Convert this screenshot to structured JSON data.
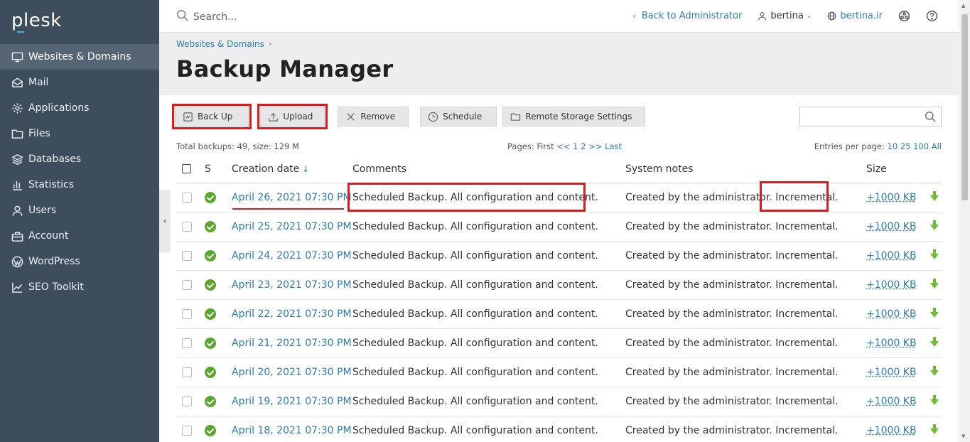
{
  "brand": {
    "logo_text": "plesk"
  },
  "sidebar": {
    "items": [
      {
        "label": "Websites & Domains",
        "icon": "monitor-icon",
        "active": true
      },
      {
        "label": "Mail",
        "icon": "mail-icon",
        "active": false
      },
      {
        "label": "Applications",
        "icon": "gear-icon",
        "active": false
      },
      {
        "label": "Files",
        "icon": "folder-icon",
        "active": false
      },
      {
        "label": "Databases",
        "icon": "database-icon",
        "active": false
      },
      {
        "label": "Statistics",
        "icon": "bar-chart-icon",
        "active": false
      },
      {
        "label": "Users",
        "icon": "user-icon",
        "active": false
      },
      {
        "label": "Account",
        "icon": "briefcase-icon",
        "active": false
      },
      {
        "label": "WordPress",
        "icon": "wordpress-icon",
        "active": false
      },
      {
        "label": "SEO Toolkit",
        "icon": "seo-chart-icon",
        "active": false
      }
    ],
    "collapse_glyph": "‹"
  },
  "topbar": {
    "search_placeholder": "Search...",
    "back_label": "Back to Administrator",
    "user_name": "bertina",
    "domain": "bertina.ir"
  },
  "header": {
    "breadcrumb": "Websites & Domains",
    "title": "Backup Manager"
  },
  "toolbar": {
    "backup_label": "Back Up",
    "upload_label": "Upload",
    "remove_label": "Remove",
    "schedule_label": "Schedule",
    "remote_label": "Remote Storage Settings"
  },
  "summary": {
    "total": "Total backups: 49, size: 129 M",
    "pages_prefix": "Pages: ",
    "first": "First",
    "prev": "<<",
    "page1": "1",
    "page2": "2",
    "next": ">>",
    "last": "Last",
    "per_prefix": "Entries per page: ",
    "per_10": "10",
    "per_25": "25",
    "per_100": "100",
    "per_all": "All"
  },
  "table": {
    "columns": {
      "status": "S",
      "date": "Creation date",
      "sort_glyph": "↓",
      "comments": "Comments",
      "notes": "System notes",
      "size": "Size"
    },
    "rows": [
      {
        "date": "April 26, 2021 07:30 PM",
        "comment": "Scheduled Backup. All configuration and content.",
        "notes": "Created by the administrator. Incremental.",
        "size": "+1000 KB"
      },
      {
        "date": "April 25, 2021 07:30 PM",
        "comment": "Scheduled Backup. All configuration and content.",
        "notes": "Created by the administrator. Incremental.",
        "size": "+1000 KB"
      },
      {
        "date": "April 24, 2021 07:30 PM",
        "comment": "Scheduled Backup. All configuration and content.",
        "notes": "Created by the administrator. Incremental.",
        "size": "+1000 KB"
      },
      {
        "date": "April 23, 2021 07:30 PM",
        "comment": "Scheduled Backup. All configuration and content.",
        "notes": "Created by the administrator. Incremental.",
        "size": "+1000 KB"
      },
      {
        "date": "April 22, 2021 07:30 PM",
        "comment": "Scheduled Backup. All configuration and content.",
        "notes": "Created by the administrator. Incremental.",
        "size": "+1000 KB"
      },
      {
        "date": "April 21, 2021 07:30 PM",
        "comment": "Scheduled Backup. All configuration and content.",
        "notes": "Created by the administrator. Incremental.",
        "size": "+1000 KB"
      },
      {
        "date": "April 20, 2021 07:30 PM",
        "comment": "Scheduled Backup. All configuration and content.",
        "notes": "Created by the administrator. Incremental.",
        "size": "+1000 KB"
      },
      {
        "date": "April 19, 2021 07:30 PM",
        "comment": "Scheduled Backup. All configuration and content.",
        "notes": "Created by the administrator. Incremental.",
        "size": "+1000 KB"
      },
      {
        "date": "April 18, 2021 07:30 PM",
        "comment": "Scheduled Backup. All configuration and content.",
        "notes": "Created by the administrator. Incremental.",
        "size": "+1000 KB"
      }
    ]
  },
  "colors": {
    "sidebar_bg": "#3e4d5b",
    "link": "#2c7cb0",
    "success": "#5aa72f",
    "highlight": "#e01a1a"
  }
}
